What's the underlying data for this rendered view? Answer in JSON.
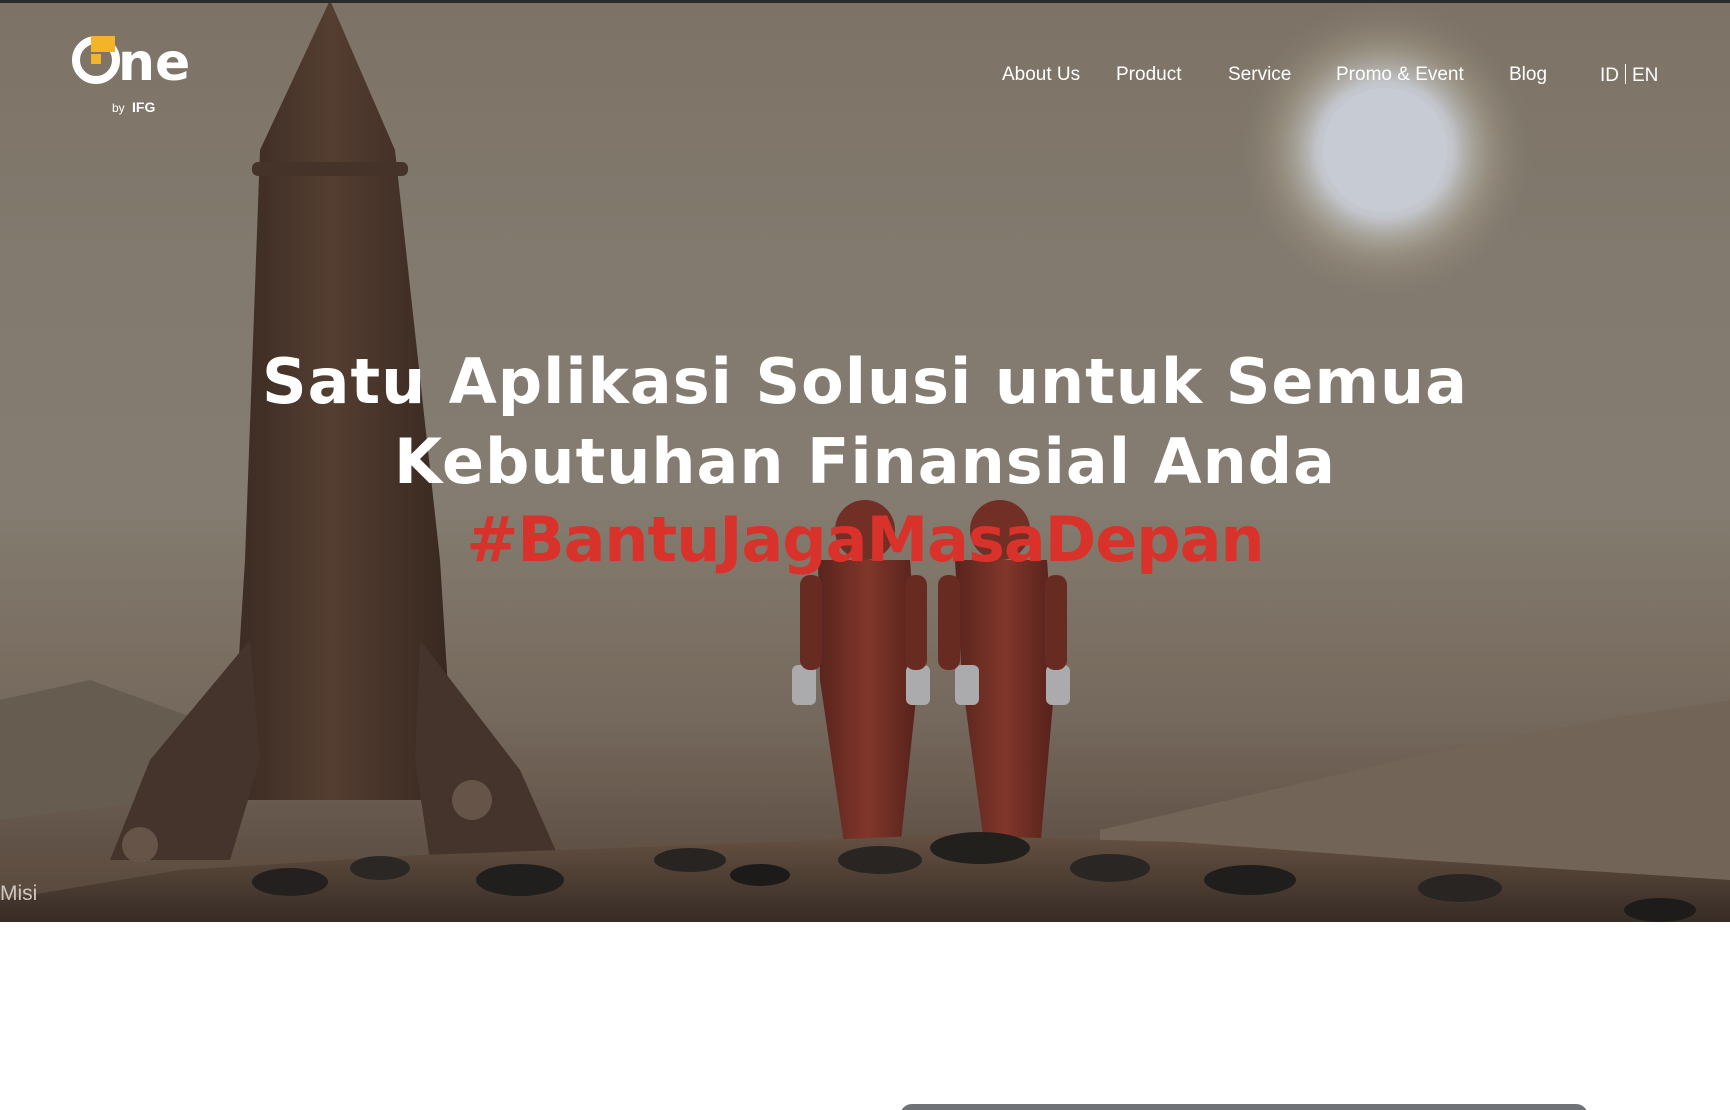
{
  "brand": {
    "logo_word": "ne",
    "logo_by": "by",
    "logo_company": "IFG",
    "colors": {
      "accent": "#f2b429",
      "hashtag": "#d9322a",
      "nav_text": "#ffffff"
    }
  },
  "nav": {
    "items": [
      {
        "label": "About Us"
      },
      {
        "label": "Product"
      },
      {
        "label": "Service"
      },
      {
        "label": "Promo & Event"
      },
      {
        "label": "Blog"
      }
    ],
    "lang": {
      "id": "ID",
      "en": "EN"
    }
  },
  "hero": {
    "headline_line1": "Satu Aplikasi Solusi untuk Semua",
    "headline_line2": "Kebutuhan Finansial Anda",
    "hashtag": "#BantuJagaMasaDepan",
    "side_label": "Misi"
  }
}
